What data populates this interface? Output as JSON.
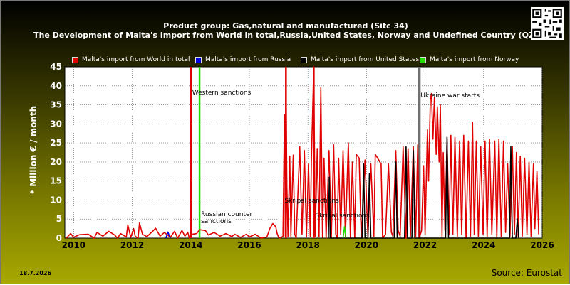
{
  "title_line1": "Product group: Gas,natural and manufactured (Sitc 34)",
  "title_line2": "The Development of Malta's Import from World in total,Russia,United States, Norway and Undefined Country (QZ)",
  "date_stamp": "18.7.2026",
  "source": "Source: Eurostat",
  "qr_icon": "qr-code-icon",
  "colors": {
    "world": "#e00000",
    "russia": "#0000dd",
    "united_states": "#000000",
    "norway": "#22dd00",
    "event_red": "#e00000",
    "event_green": "#22dd00",
    "event_gray": "#707070",
    "plot_bg": "#ffffff",
    "grid": "#555555"
  },
  "legend": [
    {
      "label": "Malta's import from World in total",
      "color": "#e00000"
    },
    {
      "label": "Malta's import from Russia",
      "color": "#0000dd"
    },
    {
      "label": "Malta's import from United States",
      "color": "#000000"
    },
    {
      "label": "Malta's import from Norway",
      "color": "#22dd00"
    }
  ],
  "chart_data": {
    "type": "line",
    "title": "The Development of Malta's Import from World in total,Russia,United States, Norway and Undefined Country (QZ)",
    "ylabel": "* Million € / month",
    "xlabel": "",
    "xlim": [
      2009.7,
      2026.0
    ],
    "ylim": [
      0,
      45
    ],
    "x_ticks": [
      2010,
      2012,
      2014,
      2016,
      2018,
      2020,
      2022,
      2024,
      2026
    ],
    "y_ticks": [
      0,
      5,
      10,
      15,
      20,
      25,
      30,
      35,
      40,
      45
    ],
    "grid": true,
    "legend_position": "top",
    "events": [
      {
        "x": 2014.0,
        "label": "Western sanctions",
        "color": "#e00000"
      },
      {
        "x": 2014.3,
        "label": "Russian counter sanctions",
        "color": "#22dd00"
      },
      {
        "x": 2017.25,
        "label": "Skripal sanctions",
        "color": "#e00000"
      },
      {
        "x": 2018.2,
        "label": "Skripal sanctions",
        "color": "#e00000"
      },
      {
        "x": 2021.8,
        "label": "Ukraine war starts",
        "color": "#707070"
      }
    ],
    "series": [
      {
        "name": "Malta's import from World in total",
        "color": "#e00000",
        "points": [
          [
            2009.75,
            0
          ],
          [
            2009.9,
            1.2
          ],
          [
            2010.0,
            0.2
          ],
          [
            2010.2,
            0.9
          ],
          [
            2010.5,
            1.0
          ],
          [
            2010.7,
            0
          ],
          [
            2010.8,
            1.5
          ],
          [
            2011.0,
            0.5
          ],
          [
            2011.2,
            1.8
          ],
          [
            2011.4,
            0.8
          ],
          [
            2011.5,
            0
          ],
          [
            2011.6,
            1.2
          ],
          [
            2011.8,
            0.3
          ],
          [
            2011.85,
            3.5
          ],
          [
            2011.95,
            0.2
          ],
          [
            2012.05,
            2.5
          ],
          [
            2012.1,
            0.5
          ],
          [
            2012.2,
            0
          ],
          [
            2012.25,
            4.0
          ],
          [
            2012.35,
            1.0
          ],
          [
            2012.5,
            0.4
          ],
          [
            2012.7,
            1.8
          ],
          [
            2012.8,
            2.6
          ],
          [
            2012.95,
            0.5
          ],
          [
            2013.1,
            1.5
          ],
          [
            2013.3,
            0.2
          ],
          [
            2013.45,
            1.8
          ],
          [
            2013.55,
            0
          ],
          [
            2013.7,
            2.0
          ],
          [
            2013.8,
            0.5
          ],
          [
            2013.9,
            1.5
          ],
          [
            2013.95,
            0
          ],
          [
            2014.05,
            1.0
          ],
          [
            2014.2,
            1.2
          ],
          [
            2014.3,
            2.2
          ],
          [
            2014.5,
            2.0
          ],
          [
            2014.6,
            0.8
          ],
          [
            2014.8,
            1.5
          ],
          [
            2015.0,
            0.5
          ],
          [
            2015.2,
            1.2
          ],
          [
            2015.4,
            0.4
          ],
          [
            2015.5,
            1.0
          ],
          [
            2015.7,
            0.2
          ],
          [
            2015.9,
            1.0
          ],
          [
            2016.0,
            0.3
          ],
          [
            2016.2,
            1.0
          ],
          [
            2016.4,
            0
          ],
          [
            2016.6,
            0.3
          ],
          [
            2016.7,
            2.5
          ],
          [
            2016.8,
            3.8
          ],
          [
            2016.9,
            3.0
          ],
          [
            2016.95,
            1.2
          ],
          [
            2017.0,
            0.2
          ],
          [
            2017.05,
            0
          ],
          [
            2017.15,
            0.5
          ],
          [
            2017.2,
            32.5
          ],
          [
            2017.23,
            0.5
          ],
          [
            2017.25,
            45
          ],
          [
            2017.28,
            14.0
          ],
          [
            2017.32,
            0.5
          ],
          [
            2017.38,
            21.5
          ],
          [
            2017.42,
            0.5
          ],
          [
            2017.5,
            21.8
          ],
          [
            2017.55,
            1.0
          ],
          [
            2017.6,
            0
          ],
          [
            2017.72,
            24.0
          ],
          [
            2017.8,
            1.0
          ],
          [
            2017.88,
            23.0
          ],
          [
            2017.95,
            0.3
          ],
          [
            2018.02,
            19.5
          ],
          [
            2018.08,
            0.5
          ],
          [
            2018.12,
            21.0
          ],
          [
            2018.2,
            45
          ],
          [
            2018.25,
            0.5
          ],
          [
            2018.32,
            23.5
          ],
          [
            2018.38,
            0.3
          ],
          [
            2018.44,
            39.5
          ],
          [
            2018.5,
            0.2
          ],
          [
            2018.55,
            21.0
          ],
          [
            2018.62,
            0
          ],
          [
            2018.72,
            23.0
          ],
          [
            2018.8,
            0
          ],
          [
            2018.88,
            24.5
          ],
          [
            2018.95,
            1.0
          ],
          [
            2019.0,
            0
          ],
          [
            2019.05,
            21.0
          ],
          [
            2019.12,
            1.0
          ],
          [
            2019.2,
            23.0
          ],
          [
            2019.28,
            0.5
          ],
          [
            2019.38,
            25.0
          ],
          [
            2019.45,
            0
          ],
          [
            2019.52,
            20.0
          ],
          [
            2019.6,
            0
          ],
          [
            2019.65,
            22.0
          ],
          [
            2019.75,
            21.0
          ],
          [
            2019.82,
            0
          ],
          [
            2019.95,
            20.5
          ],
          [
            2020.05,
            0.3
          ],
          [
            2020.15,
            19.5
          ],
          [
            2020.25,
            0.5
          ],
          [
            2020.3,
            22.0
          ],
          [
            2020.42,
            20.5
          ],
          [
            2020.5,
            19.5
          ],
          [
            2020.55,
            0
          ],
          [
            2020.65,
            1.0
          ],
          [
            2020.75,
            19.5
          ],
          [
            2020.85,
            1.5
          ],
          [
            2020.9,
            0.5
          ],
          [
            2021.0,
            23.0
          ],
          [
            2021.08,
            2.0
          ],
          [
            2021.15,
            0.5
          ],
          [
            2021.25,
            24.0
          ],
          [
            2021.35,
            0
          ],
          [
            2021.42,
            23.5
          ],
          [
            2021.5,
            0.5
          ],
          [
            2021.6,
            24.0
          ],
          [
            2021.68,
            0.3
          ],
          [
            2021.75,
            24.5
          ],
          [
            2021.8,
            0
          ],
          [
            2021.88,
            2.0
          ],
          [
            2021.95,
            19.0
          ],
          [
            2022.0,
            1.0
          ],
          [
            2022.08,
            28.5
          ],
          [
            2022.12,
            15.0
          ],
          [
            2022.18,
            36.5
          ],
          [
            2022.22,
            38.0
          ],
          [
            2022.27,
            26.0
          ],
          [
            2022.32,
            37.0
          ],
          [
            2022.38,
            22.0
          ],
          [
            2022.42,
            34.5
          ],
          [
            2022.48,
            20.0
          ],
          [
            2022.52,
            35.0
          ],
          [
            2022.58,
            0.5
          ],
          [
            2022.62,
            22.5
          ],
          [
            2022.68,
            2.0
          ],
          [
            2022.75,
            26.0
          ],
          [
            2022.82,
            1.0
          ],
          [
            2022.88,
            27.0
          ],
          [
            2022.95,
            1.0
          ],
          [
            2023.02,
            26.5
          ],
          [
            2023.1,
            0.5
          ],
          [
            2023.18,
            25.5
          ],
          [
            2023.25,
            1.0
          ],
          [
            2023.32,
            27.0
          ],
          [
            2023.4,
            0
          ],
          [
            2023.48,
            25.5
          ],
          [
            2023.55,
            0.5
          ],
          [
            2023.62,
            30.5
          ],
          [
            2023.68,
            1.0
          ],
          [
            2023.75,
            25.5
          ],
          [
            2023.82,
            0.5
          ],
          [
            2023.9,
            24.0
          ],
          [
            2023.98,
            1.0
          ],
          [
            2024.05,
            25.5
          ],
          [
            2024.12,
            0.5
          ],
          [
            2024.2,
            26.0
          ],
          [
            2024.28,
            1.0
          ],
          [
            2024.38,
            25.5
          ],
          [
            2024.45,
            0
          ],
          [
            2024.52,
            26.0
          ],
          [
            2024.6,
            0.5
          ],
          [
            2024.68,
            25.5
          ],
          [
            2024.75,
            1.5
          ],
          [
            2024.82,
            19.5
          ],
          [
            2024.9,
            0.5
          ],
          [
            2024.98,
            24.0
          ],
          [
            2025.05,
            1.0
          ],
          [
            2025.12,
            22.5
          ],
          [
            2025.18,
            0.5
          ],
          [
            2025.25,
            21.5
          ],
          [
            2025.32,
            0.5
          ],
          [
            2025.4,
            21.0
          ],
          [
            2025.48,
            1.0
          ],
          [
            2025.55,
            20.0
          ],
          [
            2025.62,
            0.5
          ],
          [
            2025.7,
            19.5
          ],
          [
            2025.75,
            2.5
          ],
          [
            2025.82,
            17.5
          ],
          [
            2025.88,
            1.0
          ]
        ]
      },
      {
        "name": "Malta's import from Russia",
        "color": "#0000dd",
        "points": [
          [
            2013.15,
            0
          ],
          [
            2013.22,
            1.6
          ],
          [
            2013.3,
            0
          ]
        ]
      },
      {
        "name": "Malta's import from United States",
        "color": "#000000",
        "points": [
          [
            2018.7,
            0
          ],
          [
            2018.73,
            16.0
          ],
          [
            2018.76,
            0
          ],
          [
            2019.85,
            0
          ],
          [
            2019.9,
            19.5
          ],
          [
            2019.95,
            0
          ],
          [
            2020.05,
            0
          ],
          [
            2020.1,
            17.0
          ],
          [
            2020.15,
            0
          ],
          [
            2020.95,
            0
          ],
          [
            2021.0,
            20.0
          ],
          [
            2021.05,
            0
          ],
          [
            2021.3,
            0
          ],
          [
            2021.35,
            24.0
          ],
          [
            2021.4,
            0
          ],
          [
            2021.55,
            0
          ],
          [
            2021.6,
            23.0
          ],
          [
            2021.65,
            0
          ],
          [
            2022.7,
            0
          ],
          [
            2022.75,
            26.5
          ],
          [
            2022.8,
            0
          ],
          [
            2024.88,
            0
          ],
          [
            2024.93,
            24.0
          ],
          [
            2024.98,
            0
          ],
          [
            2025.1,
            0
          ],
          [
            2025.15,
            5.0
          ],
          [
            2025.2,
            0
          ]
        ]
      },
      {
        "name": "Malta's import from Norway",
        "color": "#22dd00",
        "points": [
          [
            2019.2,
            0
          ],
          [
            2019.25,
            3.0
          ],
          [
            2019.3,
            0
          ]
        ]
      }
    ]
  }
}
